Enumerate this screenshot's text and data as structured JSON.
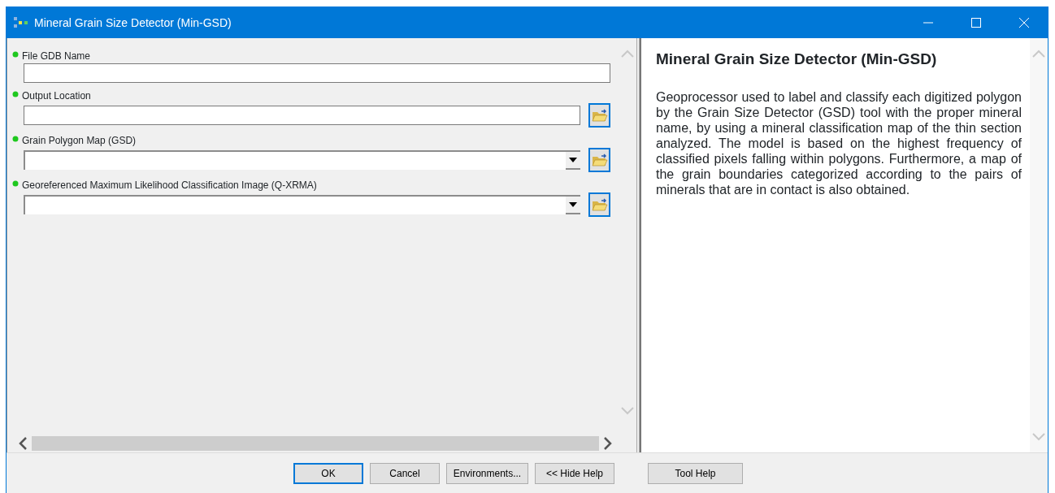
{
  "window": {
    "title": "Mineral Grain Size Detector (Min-GSD)"
  },
  "parameters": [
    {
      "label": "File GDB Name",
      "kind": "text"
    },
    {
      "label": "Output Location",
      "kind": "path"
    },
    {
      "label": "Grain Polygon Map (GSD)",
      "kind": "dropdown"
    },
    {
      "label": "Georeferenced Maximum Likelihood Classification Image (Q-XRMA)",
      "kind": "dropdown"
    }
  ],
  "help": {
    "title": "Mineral Grain Size Detector (Min-GSD)",
    "text": "Geoprocessor used to label and classify each digitized polygon by the Grain Size Detector (GSD) tool with the proper mineral name, by using a mineral classification map of the thin section analyzed. The model is based on the highest frequency of classified pixels falling within polygons. Furthermore, a map of the grain boundaries categorized according to the pairs of minerals that are in contact is also obtained."
  },
  "buttons": [
    {
      "label": "OK",
      "focused": true
    },
    {
      "label": "Cancel",
      "focused": false
    },
    {
      "label": "Environments...",
      "focused": false
    },
    {
      "label": "<< Hide Help",
      "focused": false
    }
  ],
  "tool_help_button": {
    "label": "Tool Help"
  }
}
